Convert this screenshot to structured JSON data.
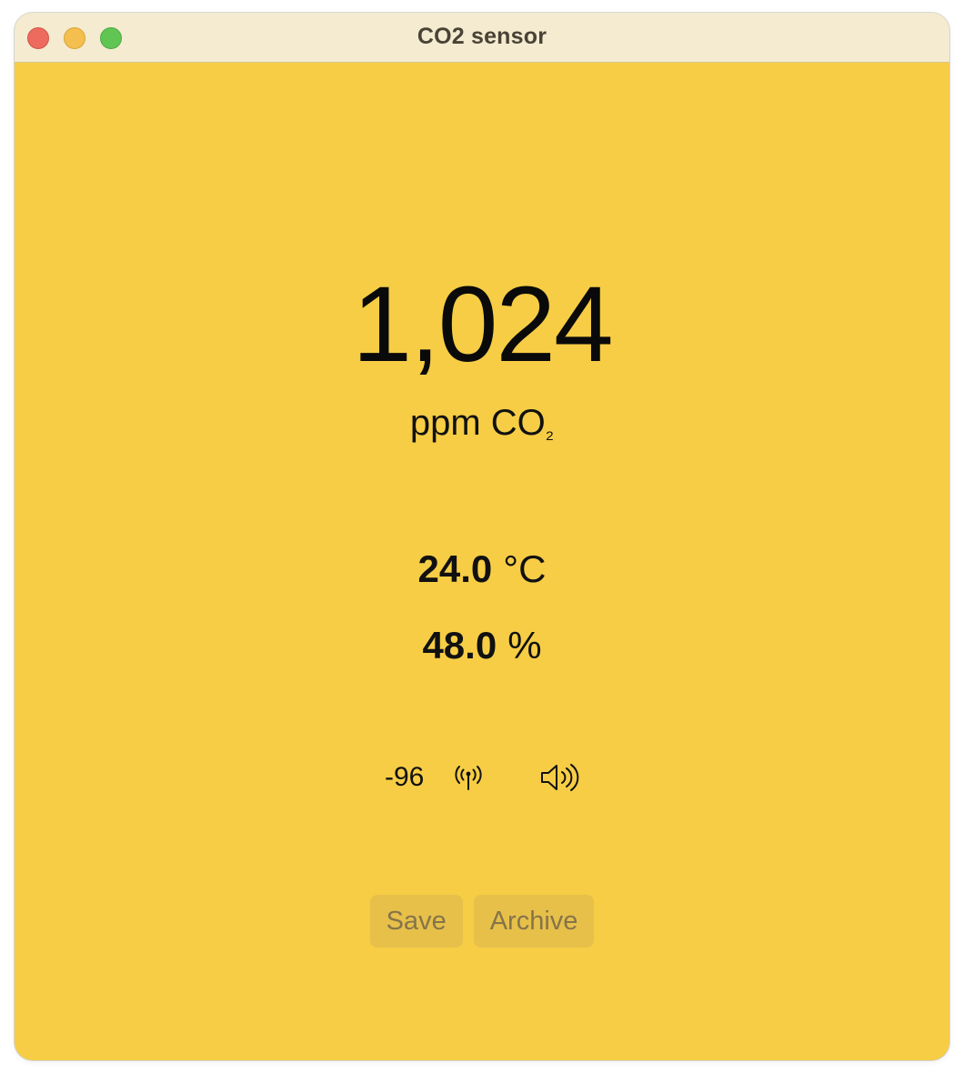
{
  "window": {
    "title": "CO2 sensor",
    "background_color": "#F6CD45",
    "titlebar_color": "#F4EBD0"
  },
  "co2": {
    "value": "1,024",
    "unit_prefix": "ppm CO",
    "unit_subscript": "₂"
  },
  "temperature": {
    "value": "24.0",
    "unit": "°C"
  },
  "humidity": {
    "value": "48.0",
    "unit": "%"
  },
  "status": {
    "rssi": "-96",
    "signal_icon": "antenna-icon",
    "sound_icon": "speaker-icon"
  },
  "actions": {
    "save_label": "Save",
    "archive_label": "Archive"
  }
}
